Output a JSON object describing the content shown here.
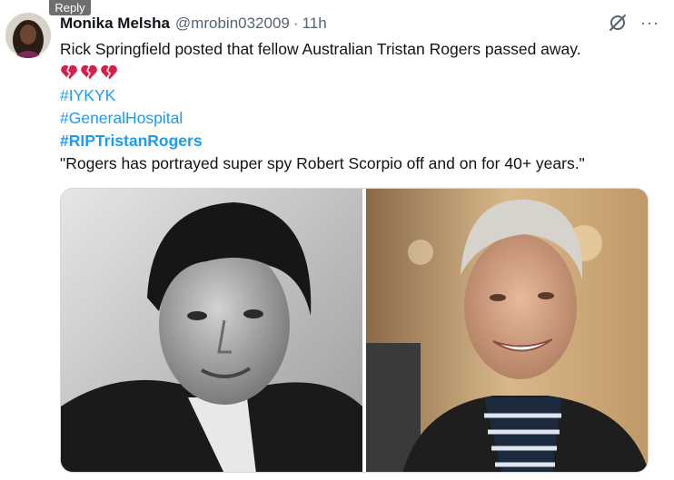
{
  "reply_tag": "Reply",
  "author": {
    "name": "Monika Melsha",
    "handle": "@mrobin032009",
    "separator": "·",
    "time": "11h"
  },
  "actions": {
    "more": "···"
  },
  "tweet": {
    "line1": "Rick Springfield posted that fellow Australian Tristan Rogers passed away.",
    "emojis": [
      "broken-heart",
      "broken-heart",
      "broken-heart"
    ],
    "hashtags": [
      "#IYKYK",
      "#GeneralHospital",
      "#RIPTristanRogers"
    ],
    "quote": "\"Rogers has portrayed super spy Robert Scorpio off and on for 40+ years.\""
  },
  "colors": {
    "link": "#1d9bf0",
    "secondary_text": "#536471",
    "primary_text": "#0f1419",
    "broken_heart": "#d6204a"
  },
  "media": {
    "left_photo": "black-and-white-portrait",
    "right_photo": "color-portrait-smiling"
  }
}
